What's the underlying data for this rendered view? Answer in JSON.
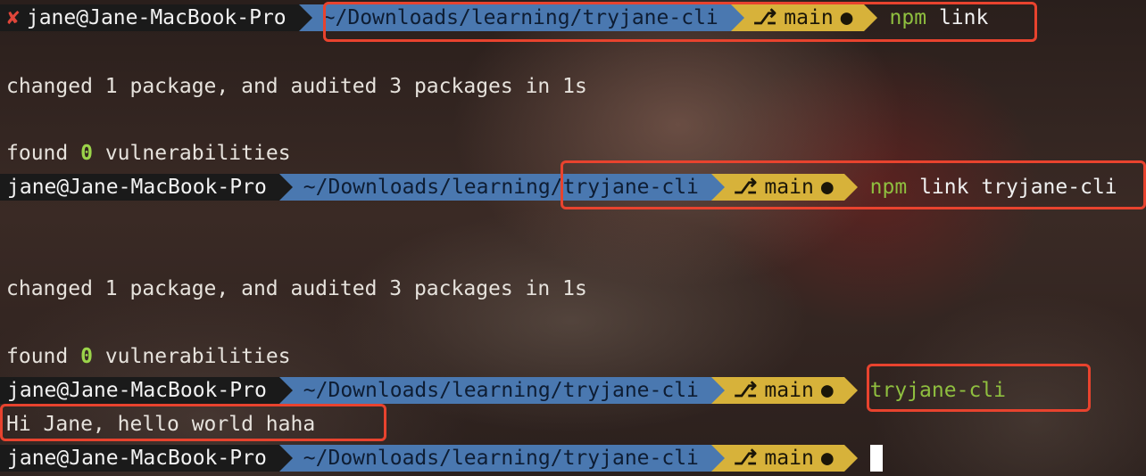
{
  "prompt": {
    "user_host": "jane@Jane-MacBook-Pro",
    "error_mark": "✘",
    "path": "~/Downloads/learning/tryjane-cli",
    "branch_icon": "⎇",
    "branch": "main",
    "dirty_mark": "●"
  },
  "commands": {
    "c1_bin": "npm",
    "c1_args": "link",
    "c2_bin": "npm",
    "c2_args": "link tryjane-cli",
    "c3": "tryjane-cli"
  },
  "output": {
    "changed": "changed 1 package, and audited 3 packages in 1s",
    "found_prefix": "found",
    "found_count": "0",
    "found_suffix": "vulnerabilities",
    "hello": "Hi Jane, hello world haha"
  },
  "colors": {
    "user_segment": "#1a1a1a",
    "path_segment": "#4a78b0",
    "git_segment": "#d7b23a",
    "command_green": "#8fbf3f",
    "highlight": "#e8432e",
    "error_red": "#e0463a"
  }
}
